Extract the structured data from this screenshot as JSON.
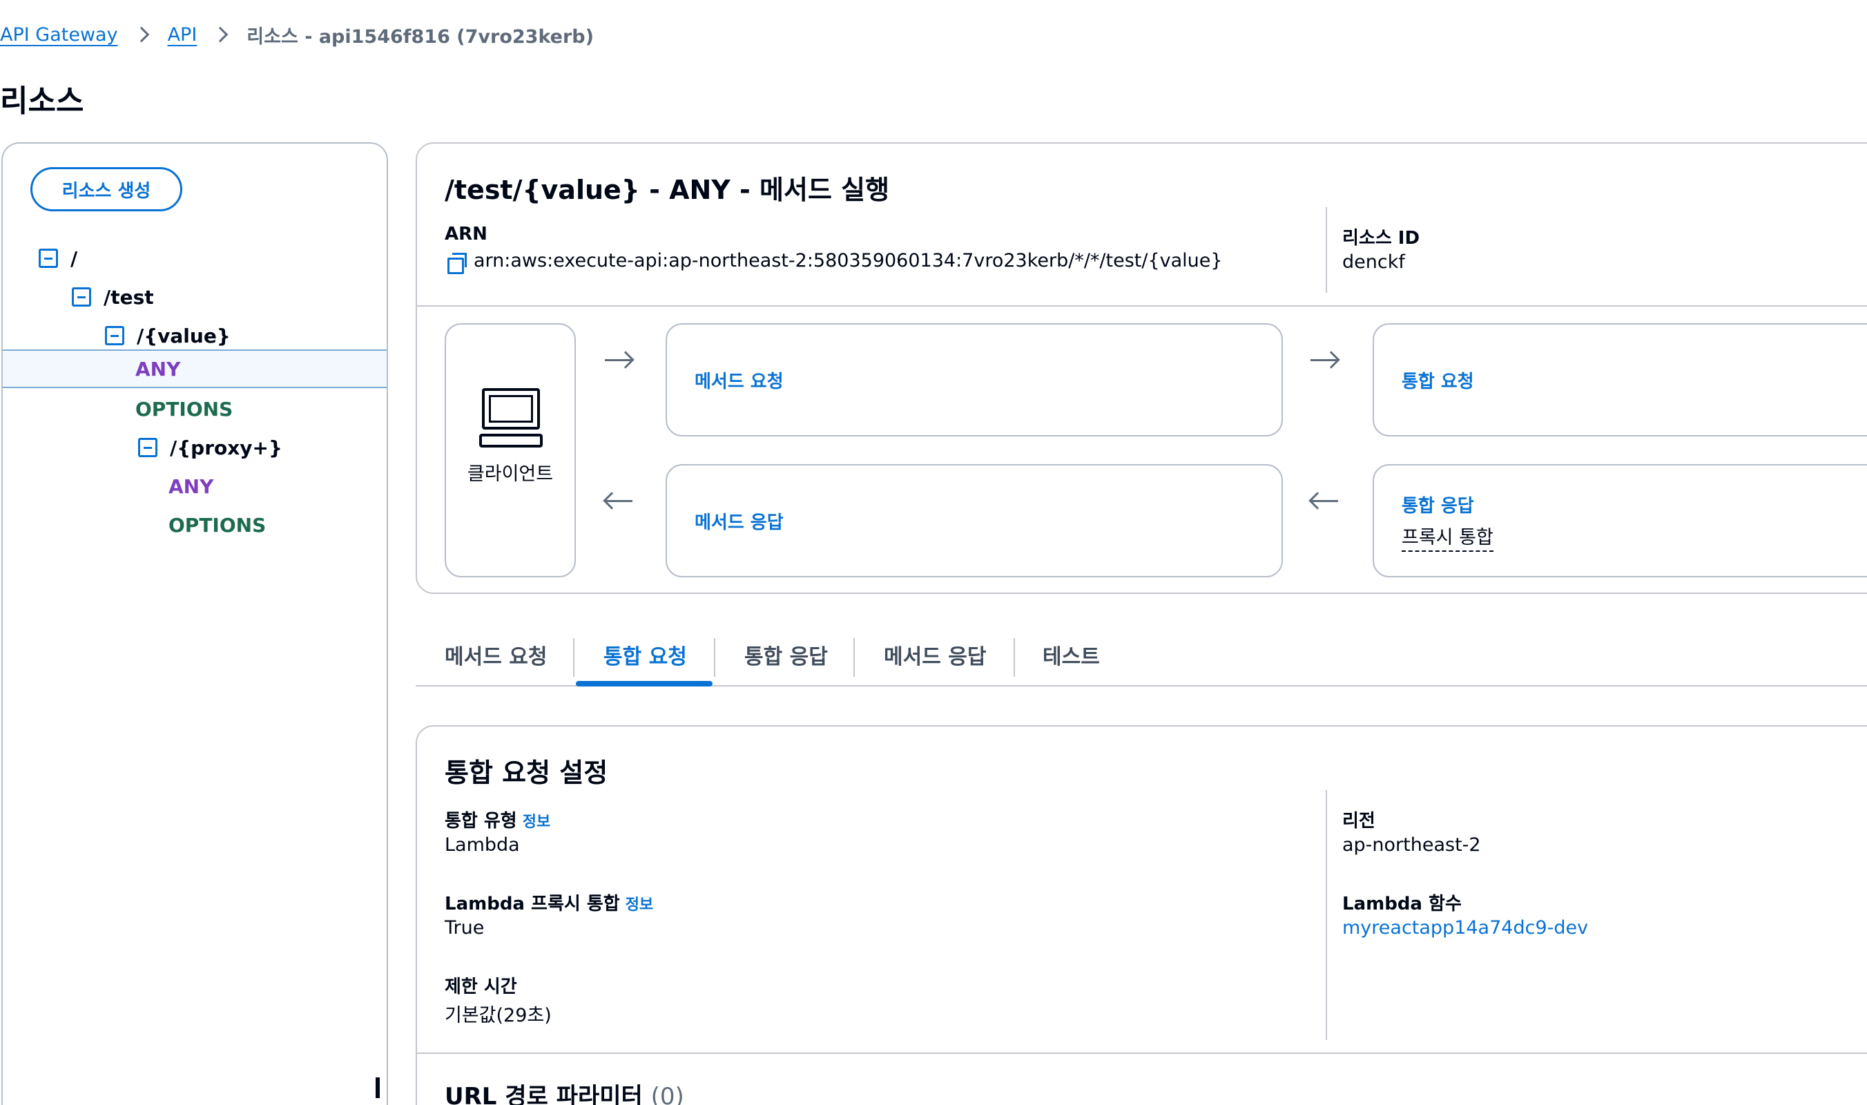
{
  "breadcrumb": {
    "items": [
      "API Gateway",
      "API"
    ],
    "current": "리소스 - api1546f816 (7vro23kerb)"
  },
  "page_title": "리소스",
  "tree": {
    "create_button": "리소스 생성",
    "nodes": [
      {
        "label": "/",
        "type": "resource"
      },
      {
        "label": "/test",
        "type": "resource"
      },
      {
        "label": "/{value}",
        "type": "resource"
      },
      {
        "label": "ANY",
        "type": "method",
        "selected": true
      },
      {
        "label": "OPTIONS",
        "type": "method"
      },
      {
        "label": "/{proxy+}",
        "type": "resource"
      },
      {
        "label": "ANY",
        "type": "method"
      },
      {
        "label": "OPTIONS",
        "type": "method"
      }
    ]
  },
  "execution": {
    "title": "/test/{value} - ANY - 메서드 실행",
    "arn_label": "ARN",
    "arn_value": "arn:aws:execute-api:ap-northeast-2:580359060134:7vro23kerb/*/*/test/{value}",
    "resource_id_label": "리소스 ID",
    "resource_id_value": "denckf",
    "client_label": "클라이언트",
    "method_request": "메서드 요청",
    "integration_request": "통합 요청",
    "method_response": "메서드 응답",
    "integration_response": "통합 응답",
    "integration_response_sub": "프록시 통합"
  },
  "tabs": [
    {
      "label": "메서드 요청",
      "active": false
    },
    {
      "label": "통합 요청",
      "active": true
    },
    {
      "label": "통합 응답",
      "active": false
    },
    {
      "label": "메서드 응답",
      "active": false
    },
    {
      "label": "테스트",
      "active": false
    }
  ],
  "settings": {
    "title": "통합 요청 설정",
    "info": "정보",
    "integration_type_label": "통합 유형",
    "integration_type_value": "Lambda",
    "proxy_label": "Lambda 프록시 통합",
    "proxy_value": "True",
    "timeout_label": "제한 시간",
    "timeout_value": "기본값(29초)",
    "region_label": "리전",
    "region_value": "ap-northeast-2",
    "function_label": "Lambda 함수",
    "function_value": "myreactapp14a74dc9-dev",
    "url_params_title": "URL 경로 파라미터",
    "url_params_count": "(0)"
  },
  "colors": {
    "link": "#0972d3",
    "method_any": "#7d3fbf",
    "method_options": "#1d6b4f",
    "border": "#c6c6cd"
  }
}
